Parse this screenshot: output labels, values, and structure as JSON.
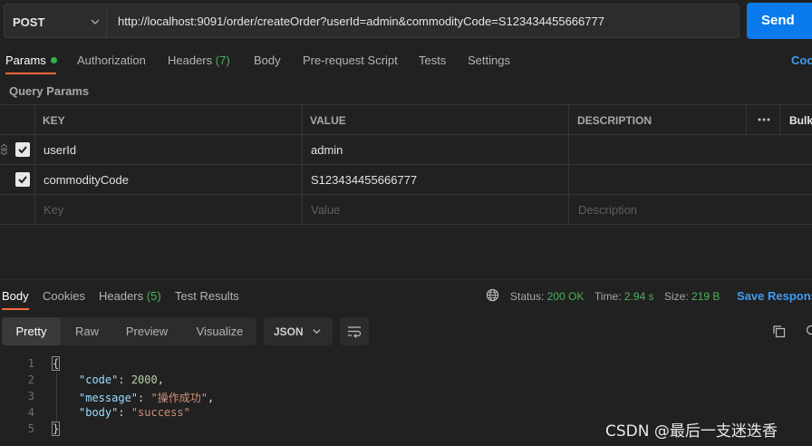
{
  "request": {
    "method": "POST",
    "url": "http://localhost:9091/order/createOrder?userId=admin&commodityCode=S123434455666777",
    "send_label": "Send"
  },
  "request_tabs": {
    "params": "Params",
    "authorization": "Authorization",
    "headers": "Headers",
    "headers_count": "(7)",
    "body": "Body",
    "pre_request": "Pre-request Script",
    "tests": "Tests",
    "settings": "Settings",
    "cookies": "Coo"
  },
  "query_params": {
    "title": "Query Params",
    "columns": {
      "key": "KEY",
      "value": "VALUE",
      "description": "DESCRIPTION",
      "bulk": "Bulk"
    },
    "rows": [
      {
        "key": "userId",
        "value": "admin",
        "checked": true
      },
      {
        "key": "commodityCode",
        "value": "S123434455666777",
        "checked": true
      }
    ],
    "placeholder": {
      "key": "Key",
      "value": "Value",
      "description": "Description"
    }
  },
  "response_tabs": {
    "body": "Body",
    "cookies": "Cookies",
    "headers": "Headers",
    "headers_count": "(5)",
    "test_results": "Test Results"
  },
  "response_status": {
    "status_label": "Status:",
    "status_value": "200 OK",
    "time_label": "Time:",
    "time_value": "2.94 s",
    "size_label": "Size:",
    "size_value": "219 B",
    "save_label": "Save Respons"
  },
  "format": {
    "pretty": "Pretty",
    "raw": "Raw",
    "preview": "Preview",
    "visualize": "Visualize",
    "language": "JSON"
  },
  "code_lines": {
    "l1": {
      "num": "1",
      "open": "{"
    },
    "l2": {
      "num": "2",
      "key": "\"code\"",
      "colon": ": ",
      "value": "2000",
      "comma": ","
    },
    "l3": {
      "num": "3",
      "key": "\"message\"",
      "colon": ": ",
      "value": "\"操作成功\"",
      "comma": ","
    },
    "l4": {
      "num": "4",
      "key": "\"body\"",
      "colon": ": ",
      "value": "\"success\""
    },
    "l5": {
      "num": "5",
      "close": "}"
    }
  },
  "watermark": "CSDN @最后一支迷迭香",
  "colors": {
    "accent": "#f26b3a",
    "send": "#097bed",
    "success": "#49b35a",
    "link": "#3f9cf2"
  }
}
